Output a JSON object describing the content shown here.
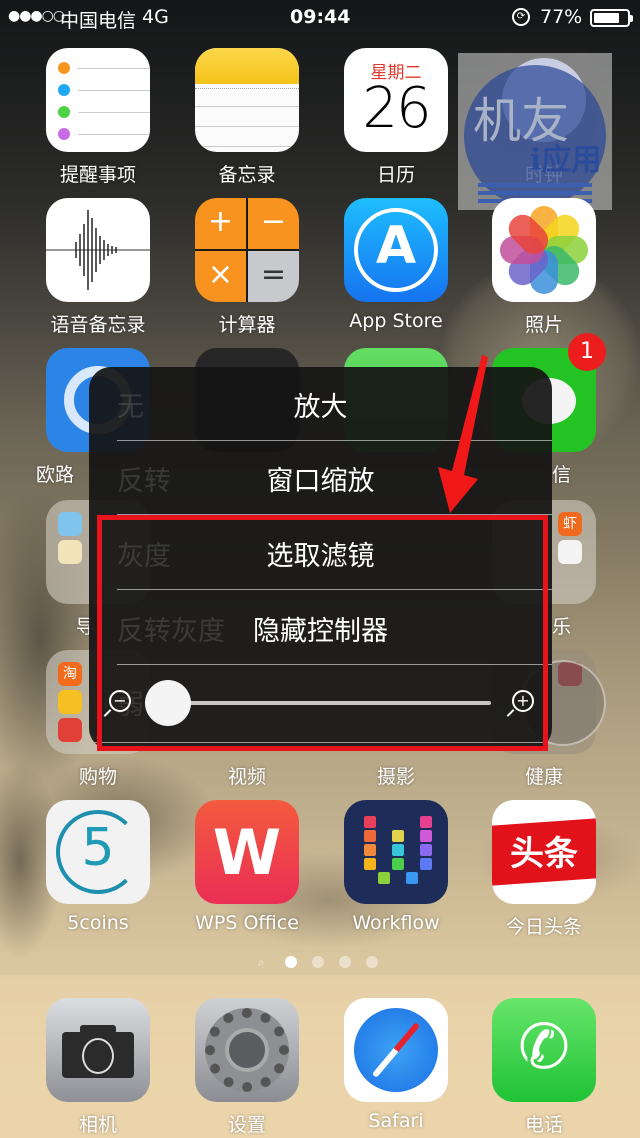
{
  "status_bar": {
    "signal": "●●●○○",
    "carrier": "中国电信",
    "network": "4G",
    "time": "09:44",
    "rotation_lock": "🔒",
    "battery_percent": "77%",
    "battery_level": 0.77
  },
  "home": {
    "row1": [
      {
        "name": "reminders",
        "label": "提醒事项"
      },
      {
        "name": "notes",
        "label": "备忘录"
      },
      {
        "name": "calendar",
        "label": "日历",
        "weekday": "星期二",
        "day": "26"
      },
      {
        "name": "clock",
        "label": "时钟"
      }
    ],
    "row2": [
      {
        "name": "voice-memos",
        "label": "语音备忘录"
      },
      {
        "name": "calculator",
        "label": "计算器",
        "keys": [
          "+",
          "−",
          "×",
          "="
        ]
      },
      {
        "name": "app-store",
        "label": "App Store",
        "glyph": "A"
      },
      {
        "name": "photos",
        "label": "照片"
      }
    ],
    "row3": [
      {
        "name": "ouyu",
        "label": "欧路"
      },
      {
        "name": "wechat",
        "label": "信",
        "badge": "1"
      }
    ],
    "row4_folders": [
      {
        "name": "folder-navigation",
        "label": "导"
      },
      {
        "name": "folder-music",
        "label": "乐",
        "mini": [
          "虾"
        ]
      }
    ],
    "row5": [
      {
        "name": "folder-shopping",
        "label": "购物",
        "mini": [
          "淘"
        ]
      },
      {
        "name": "folder-video",
        "label": "视频"
      },
      {
        "name": "folder-photography",
        "label": "摄影"
      },
      {
        "name": "folder-health",
        "label": "健康"
      }
    ],
    "row6": [
      {
        "name": "5coins",
        "label": "5coins",
        "glyph": "5"
      },
      {
        "name": "wps-office",
        "label": "WPS Office",
        "glyph": "W"
      },
      {
        "name": "workflow",
        "label": "Workflow"
      },
      {
        "name": "toutiao",
        "label": "今日头条",
        "glyph": "头条"
      }
    ],
    "page_dots": {
      "count": 4,
      "active": 1,
      "search": "⌕"
    }
  },
  "dock": [
    {
      "name": "camera",
      "label": "相机"
    },
    {
      "name": "settings",
      "label": "设置"
    },
    {
      "name": "safari",
      "label": "Safari"
    },
    {
      "name": "phone",
      "label": "电话",
      "glyph": "✆"
    }
  ],
  "watermark": {
    "text1": "机友",
    "text2": "i应用"
  },
  "zoom_menu": {
    "items": [
      {
        "label": "放大",
        "ghost": "无"
      },
      {
        "label": "窗口缩放",
        "ghost": "反转"
      },
      {
        "label": "选取滤镜",
        "ghost": "灰度"
      },
      {
        "label": "隐藏控制器",
        "ghost": "反转灰度"
      }
    ],
    "slider": {
      "ghost": "弱",
      "value": 0.0,
      "min_icon": "−",
      "max_icon": "+"
    }
  },
  "annotation": {
    "highlight_color": "#e8141c",
    "arrow_color": "#f01818"
  }
}
